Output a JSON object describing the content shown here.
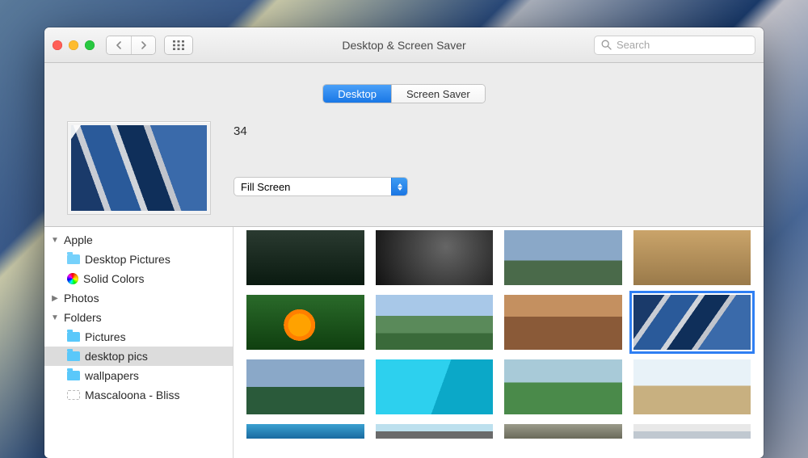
{
  "window": {
    "title": "Desktop & Screen Saver"
  },
  "search": {
    "placeholder": "Search"
  },
  "tabs": {
    "desktop": "Desktop",
    "screensaver": "Screen Saver",
    "active": "desktop"
  },
  "current": {
    "name": "34",
    "fill_mode": "Fill Screen"
  },
  "sidebar": {
    "apple": {
      "label": "Apple",
      "expanded": true,
      "desktop_pictures": "Desktop Pictures",
      "solid_colors": "Solid Colors"
    },
    "photos": {
      "label": "Photos",
      "expanded": false
    },
    "folders": {
      "label": "Folders",
      "expanded": true,
      "items": [
        {
          "label": "Pictures"
        },
        {
          "label": "desktop pics",
          "selected": true
        },
        {
          "label": "wallpapers"
        },
        {
          "label": "Mascaloona - Bliss",
          "dashed": true
        }
      ]
    }
  },
  "thumbnails": {
    "selected_index": 7
  }
}
